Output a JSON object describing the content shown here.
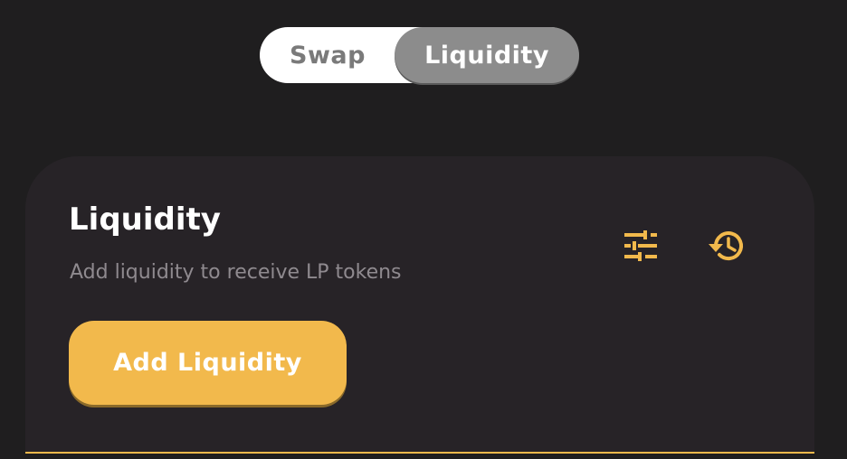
{
  "tabs": {
    "swap_label": "Swap",
    "liquidity_label": "Liquidity",
    "active": "Liquidity"
  },
  "card": {
    "title": "Liquidity",
    "subtitle": "Add liquidity to receive LP tokens",
    "settings_icon": "sliders-icon",
    "history_icon": "history-icon",
    "add_button_label": "Add Liquidity"
  },
  "colors": {
    "accent": "#f2b94c",
    "background": "#1f1e1f",
    "card": "#272327"
  }
}
